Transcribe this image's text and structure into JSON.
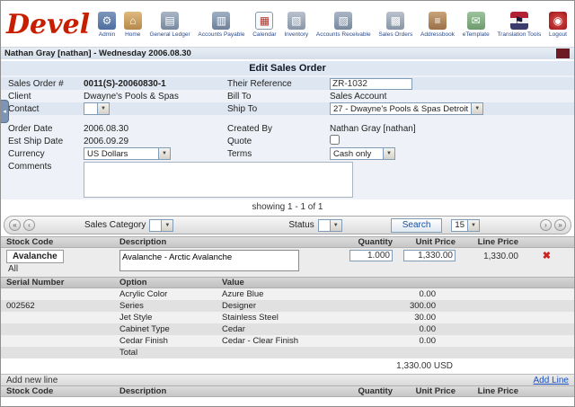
{
  "logo": "Devel",
  "nav": {
    "items": [
      {
        "label": "Admin",
        "glyph": "⚙"
      },
      {
        "label": "Home",
        "glyph": "⌂"
      },
      {
        "label": "General Ledger",
        "glyph": "▤"
      },
      {
        "label": "Accounts Payable",
        "glyph": "▥"
      },
      {
        "label": "Calendar",
        "glyph": "▦"
      },
      {
        "label": "Inventory",
        "glyph": "▧"
      },
      {
        "label": "Accounts Receivable",
        "glyph": "▨"
      },
      {
        "label": "Sales Orders",
        "glyph": "▩"
      },
      {
        "label": "Addressbook",
        "glyph": "≡"
      },
      {
        "label": "eTemplate",
        "glyph": "✉"
      },
      {
        "label": "Translation Tools",
        "glyph": "⚑"
      },
      {
        "label": "Logout",
        "glyph": "◉"
      }
    ]
  },
  "userbar": {
    "text": "Nathan Gray [nathan] - Wednesday 2006.08.30"
  },
  "page": {
    "title": "Edit Sales Order"
  },
  "form": {
    "sales_order_label": "Sales Order #",
    "sales_order_value": "0011(S)-20060830-1",
    "their_reference_label": "Their Reference",
    "their_reference_value": "ZR-1032",
    "client_label": "Client",
    "client_value": "Dwayne's Pools & Spas",
    "bill_to_label": "Bill To",
    "bill_to_value": "Sales Account",
    "contact_label": "Contact",
    "contact_value": "",
    "ship_to_label": "Ship To",
    "ship_to_value": "27 - Dwayne's Pools & Spas Detroit",
    "order_date_label": "Order Date",
    "order_date_value": "2006.08.30",
    "created_by_label": "Created By",
    "created_by_value": "Nathan Gray [nathan]",
    "est_ship_date_label": "Est Ship Date",
    "est_ship_date_value": "2006.09.29",
    "quote_label": "Quote",
    "currency_label": "Currency",
    "currency_value": "US Dollars",
    "terms_label": "Terms",
    "terms_value": "Cash only",
    "comments_label": "Comments",
    "comments_value": ""
  },
  "pagination": {
    "showing": "showing 1 - 1 of 1"
  },
  "filterbar": {
    "sales_category_label": "Sales Category",
    "status_label": "Status",
    "search_button": "Search",
    "page_size": "15",
    "first_icon": "«",
    "prev_icon": "‹",
    "next_icon": "›",
    "last_icon": "»"
  },
  "ui": {
    "select_arrow": "▼",
    "delete_glyph": "✖",
    "side_tab_arrow": "◂"
  },
  "line_table": {
    "headers": [
      "Stock Code",
      "Description",
      "Quantity",
      "Unit Price",
      "Line Price"
    ],
    "line": {
      "stock_code": "Avalanche",
      "stock_sub": "All",
      "description": "Avalanche - Arctic Avalanche",
      "quantity": "1.000",
      "unit_price": "1,330.00",
      "line_price": "1,330.00"
    },
    "options": {
      "headers": [
        "Serial Number",
        "Option",
        "Value"
      ],
      "rows": [
        {
          "serial": "",
          "option": "Acrylic Color",
          "value": "Azure Blue",
          "price": "0.00"
        },
        {
          "serial": "002562",
          "option": "Series",
          "value": "Designer",
          "price": "300.00"
        },
        {
          "serial": "",
          "option": "Jet Style",
          "value": "Stainless Steel",
          "price": "30.00"
        },
        {
          "serial": "",
          "option": "Cabinet Type",
          "value": "Cedar",
          "price": "0.00"
        },
        {
          "serial": "",
          "option": "Cedar Finish",
          "value": "Cedar - Clear Finish",
          "price": "0.00"
        },
        {
          "serial": "",
          "option": "Total",
          "value": "",
          "price": ""
        }
      ]
    },
    "total": "1,330.00 USD",
    "add_new_line": "Add new line",
    "add_line_link": "Add Line"
  }
}
